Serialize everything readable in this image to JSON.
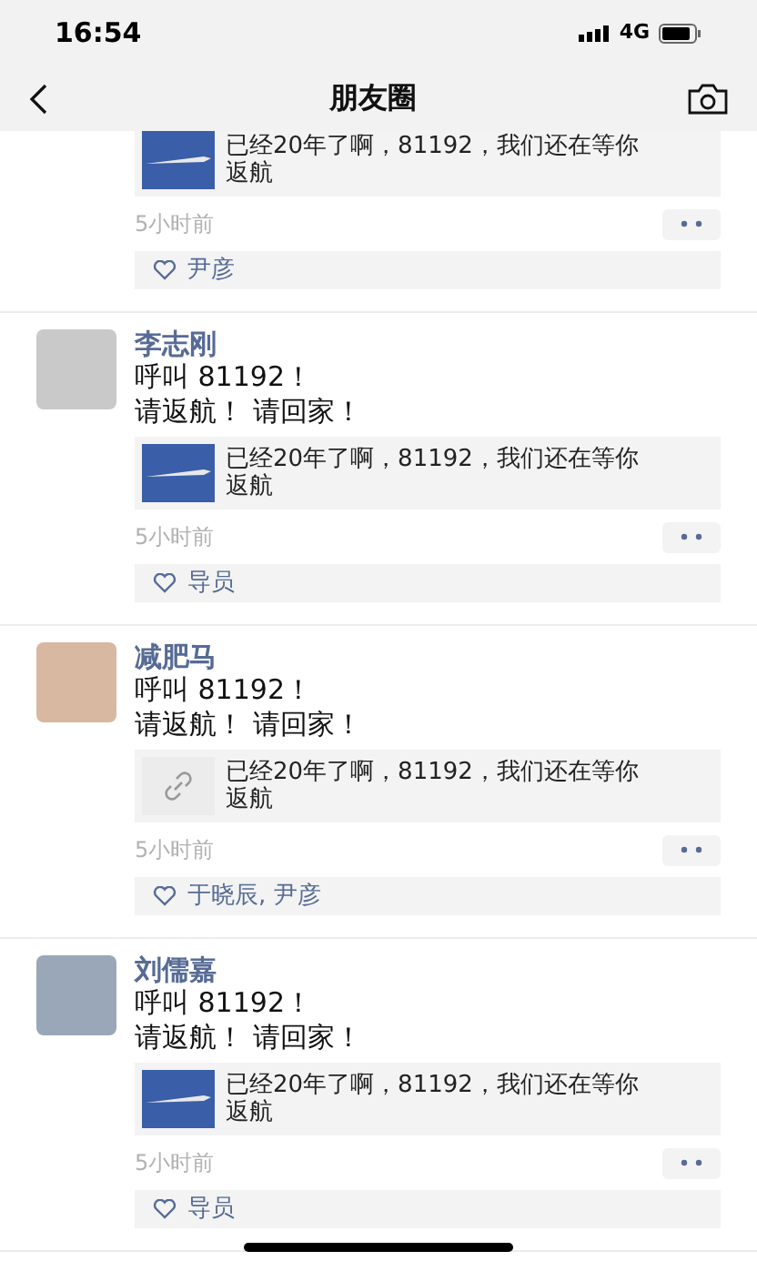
{
  "status_bar": {
    "time": "16:54",
    "network": "4G"
  },
  "nav": {
    "title": "朋友圈"
  },
  "posts": [
    {
      "link": {
        "kind": "image",
        "text": "已经20年了啊，81192，我们还在等你返航"
      },
      "time": "5小时前",
      "likes": "尹彦"
    },
    {
      "name": "李志刚",
      "text": [
        "呼叫 81192！",
        "请返航！ 请回家！"
      ],
      "link": {
        "kind": "image",
        "text": "已经20年了啊，81192，我们还在等你返航"
      },
      "time": "5小时前",
      "likes": "导员"
    },
    {
      "name": "减肥马",
      "text": [
        "呼叫 81192！",
        "请返航！ 请回家！"
      ],
      "link": {
        "kind": "link",
        "text": "已经20年了啊，81192，我们还在等你返航"
      },
      "time": "5小时前",
      "likes": "于晓辰, 尹彦"
    },
    {
      "name": "刘儒嘉",
      "text": [
        "呼叫 81192！",
        "请返航！ 请回家！"
      ],
      "link": {
        "kind": "image",
        "text": "已经20年了啊，81192，我们还在等你返航"
      },
      "time": "5小时前",
      "likes": "导员"
    }
  ]
}
